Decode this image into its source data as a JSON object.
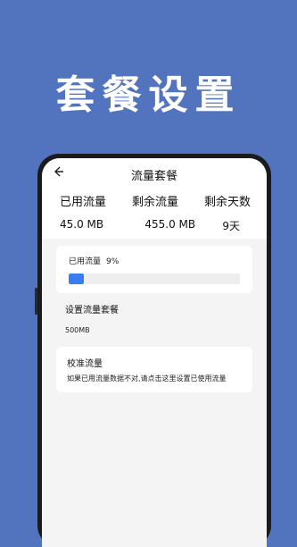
{
  "banner": {
    "title": "套餐设置"
  },
  "header": {
    "title": "流量套餐"
  },
  "stats": {
    "used_label": "已用流量",
    "remaining_label": "剩余流量",
    "days_label": "剩余天数",
    "used_value": "45.0 MB",
    "remaining_value": "455.0 MB",
    "days_value": "9天"
  },
  "usage": {
    "label": "已用流量",
    "percent_text": "9%",
    "percent": 9,
    "bar_color": "#3a7bf0"
  },
  "plan": {
    "title": "设置流量套餐",
    "value": "500MB"
  },
  "calibrate": {
    "title": "校准流量",
    "description": "如果已用流量数据不对,请点击这里设置已使用流量"
  },
  "colors": {
    "background": "#5274bf",
    "accent": "#3a7bf0"
  },
  "icons": {
    "back": "arrow-left-icon"
  }
}
